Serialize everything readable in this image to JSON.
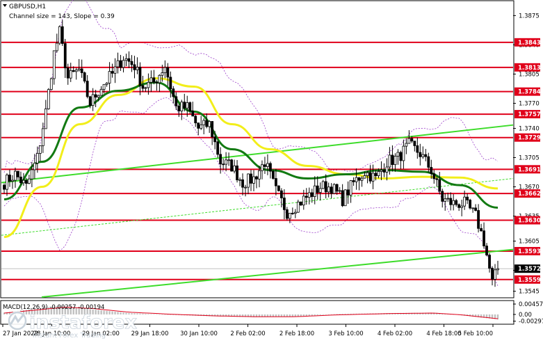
{
  "header": {
    "symbol_label": "GBPUSD,H1",
    "channel_label": "Channel size = 143, Slope = 0.39"
  },
  "macd_label": "MACD(12,26,9) -0.00257 -0.00194",
  "logo": {
    "brand": "instaforex",
    "tagline": "Instant Forex Trading"
  },
  "colors": {
    "level_line": "#e0001a",
    "level_tag": "#e0001a",
    "current_tag": "#000000",
    "ma_fast": "#127a12",
    "ma_slow": "#f2ee1a",
    "channel": "#3ddc2a",
    "bollinger": "#9b3ec9",
    "candle": "#000000",
    "macd_hist": "#c0c0c0",
    "macd_signal": "#e0001a"
  },
  "chart_data": {
    "type": "candlestick",
    "symbol": "GBPUSD",
    "timeframe": "H1",
    "price_range": [
      1.3538,
      1.3892
    ],
    "price_ticks": [
      "1.3875",
      "1.3840",
      "1.3805",
      "1.3770",
      "1.3740",
      "1.3705",
      "1.3670",
      "1.3635",
      "1.3605",
      "1.3570",
      "1.3545"
    ],
    "levels": [
      "1.3843",
      "1.3813",
      "1.3784",
      "1.3757",
      "1.3729",
      "1.3691",
      "1.3662",
      "1.3630",
      "1.3593",
      "1.3559"
    ],
    "current_price": "1.3572",
    "time_labels": [
      "27 Jan 2022",
      "28 Jan 10:00",
      "29 Jan 02:00",
      "29 Jan 18:00",
      "30 Jan 10:00",
      "2 Feb 02:00",
      "2 Feb 18:00",
      "3 Feb 10:00",
      "4 Feb 02:00",
      "4 Feb 18:00",
      "5 Feb 10:00"
    ],
    "close_path": [
      [
        0,
        1.3675
      ],
      [
        4,
        1.3685
      ],
      [
        8,
        1.367
      ],
      [
        12,
        1.3705
      ],
      [
        15,
        1.376
      ],
      [
        18,
        1.383
      ],
      [
        20,
        1.3855
      ],
      [
        23,
        1.38
      ],
      [
        27,
        1.381
      ],
      [
        31,
        1.377
      ],
      [
        35,
        1.379
      ],
      [
        39,
        1.3805
      ],
      [
        43,
        1.3825
      ],
      [
        47,
        1.3815
      ],
      [
        50,
        1.379
      ],
      [
        54,
        1.3795
      ],
      [
        58,
        1.3815
      ],
      [
        62,
        1.3765
      ],
      [
        66,
        1.3765
      ],
      [
        70,
        1.374
      ],
      [
        74,
        1.3745
      ],
      [
        78,
        1.37
      ],
      [
        82,
        1.3695
      ],
      [
        86,
        1.3675
      ],
      [
        90,
        1.368
      ],
      [
        94,
        1.37
      ],
      [
        98,
        1.3665
      ],
      [
        102,
        1.364
      ],
      [
        106,
        1.365
      ],
      [
        110,
        1.366
      ],
      [
        114,
        1.367
      ],
      [
        118,
        1.367
      ],
      [
        122,
        1.3655
      ],
      [
        126,
        1.3675
      ],
      [
        130,
        1.3688
      ],
      [
        134,
        1.368
      ],
      [
        138,
        1.37
      ],
      [
        142,
        1.3705
      ],
      [
        146,
        1.372
      ],
      [
        150,
        1.371
      ],
      [
        154,
        1.369
      ],
      [
        158,
        1.3655
      ],
      [
        162,
        1.365
      ],
      [
        166,
        1.365
      ],
      [
        170,
        1.3635
      ],
      [
        173,
        1.3605
      ],
      [
        176,
        1.3555
      ],
      [
        178,
        1.3572
      ]
    ],
    "series": [
      {
        "values": [
          1.3655,
          1.37,
          1.3765,
          1.3785,
          1.3795,
          1.376,
          1.3715,
          1.369,
          1.368,
          1.3685,
          1.369,
          1.3688,
          1.3672,
          1.3645
        ]
      },
      {
        "values": [
          1.361,
          1.367,
          1.3745,
          1.378,
          1.38,
          1.379,
          1.3745,
          1.3715,
          1.3695,
          1.3685,
          1.368,
          1.3682,
          1.3681,
          1.3668
        ]
      }
    ],
    "macd": {
      "ticks": [
        "0.00457",
        "0.00",
        "-0.00297"
      ],
      "range": [
        -0.004,
        0.0058
      ],
      "hist_path": [
        [
          0,
          0.0008
        ],
        [
          12,
          0.0026
        ],
        [
          20,
          0.0038
        ],
        [
          30,
          0.0024
        ],
        [
          45,
          0.0006
        ],
        [
          60,
          -0.0002
        ],
        [
          75,
          -0.0008
        ],
        [
          90,
          -0.0012
        ],
        [
          105,
          -0.001
        ],
        [
          120,
          0.0002
        ],
        [
          140,
          0.0006
        ],
        [
          155,
          0.0008
        ],
        [
          165,
          -0.0004
        ],
        [
          178,
          -0.0022
        ]
      ],
      "signal_path": [
        [
          0,
          0.0006
        ],
        [
          12,
          0.002
        ],
        [
          22,
          0.0032
        ],
        [
          32,
          0.0026
        ],
        [
          45,
          0.001
        ],
        [
          60,
          0.0001
        ],
        [
          75,
          -0.0006
        ],
        [
          90,
          -0.001
        ],
        [
          105,
          -0.001
        ],
        [
          120,
          -0.0002
        ],
        [
          140,
          0.0004
        ],
        [
          155,
          0.0006
        ],
        [
          165,
          -0.0002
        ],
        [
          178,
          -0.0019
        ]
      ]
    }
  }
}
